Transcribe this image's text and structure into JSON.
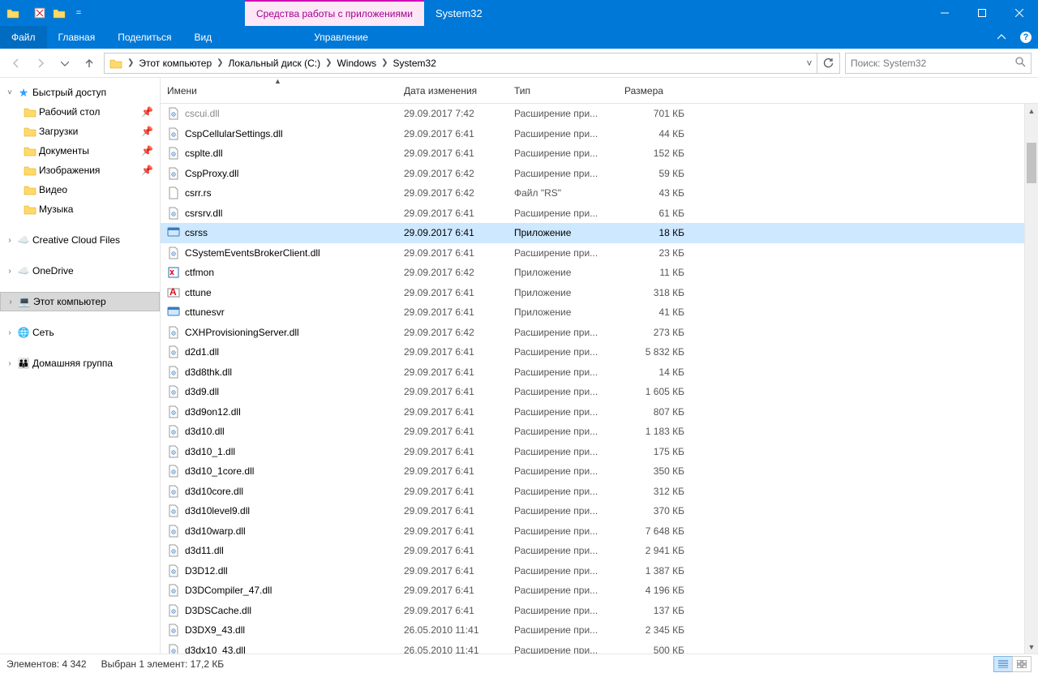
{
  "title": {
    "context_tab": "Средства работы с приложениями",
    "window": "System32"
  },
  "ribbon": {
    "file": "Файл",
    "tabs": [
      "Главная",
      "Поделиться",
      "Вид"
    ],
    "management": "Управление"
  },
  "address": {
    "crumbs": [
      "Этот компьютер",
      "Локальный диск (C:)",
      "Windows",
      "System32"
    ]
  },
  "search": {
    "placeholder": "Поиск: System32"
  },
  "nav": {
    "quick_access": "Быстрый доступ",
    "pinned": [
      {
        "label": "Рабочий стол"
      },
      {
        "label": "Загрузки"
      },
      {
        "label": "Документы"
      },
      {
        "label": "Изображения"
      },
      {
        "label": "Видео"
      },
      {
        "label": "Музыка"
      }
    ],
    "creative": "Creative Cloud Files",
    "onedrive": "OneDrive",
    "this_pc": "Этот компьютер",
    "network": "Сеть",
    "homegroup": "Домашняя группа"
  },
  "columns": {
    "name": "Имени",
    "date": "Дата изменения",
    "type": "Тип",
    "size": "Размера"
  },
  "files": [
    {
      "name": "cscui.dll",
      "date": "29.09.2017 7:42",
      "type": "Расширение при...",
      "size": "701 КБ",
      "icon": "dll",
      "cut": true
    },
    {
      "name": "CspCellularSettings.dll",
      "date": "29.09.2017 6:41",
      "type": "Расширение при...",
      "size": "44 КБ",
      "icon": "dll"
    },
    {
      "name": "csplte.dll",
      "date": "29.09.2017 6:41",
      "type": "Расширение при...",
      "size": "152 КБ",
      "icon": "dll"
    },
    {
      "name": "CspProxy.dll",
      "date": "29.09.2017 6:42",
      "type": "Расширение при...",
      "size": "59 КБ",
      "icon": "dll"
    },
    {
      "name": "csrr.rs",
      "date": "29.09.2017 6:42",
      "type": "Файл \"RS\"",
      "size": "43 КБ",
      "icon": "file"
    },
    {
      "name": "csrsrv.dll",
      "date": "29.09.2017 6:41",
      "type": "Расширение при...",
      "size": "61 КБ",
      "icon": "dll"
    },
    {
      "name": "csrss",
      "date": "29.09.2017 6:41",
      "type": "Приложение",
      "size": "18 КБ",
      "icon": "exe",
      "selected": true
    },
    {
      "name": "CSystemEventsBrokerClient.dll",
      "date": "29.09.2017 6:41",
      "type": "Расширение при...",
      "size": "23 КБ",
      "icon": "dll"
    },
    {
      "name": "ctfmon",
      "date": "29.09.2017 6:42",
      "type": "Приложение",
      "size": "11 КБ",
      "icon": "exe2"
    },
    {
      "name": "cttune",
      "date": "29.09.2017 6:41",
      "type": "Приложение",
      "size": "318 КБ",
      "icon": "exe3"
    },
    {
      "name": "cttunesvr",
      "date": "29.09.2017 6:41",
      "type": "Приложение",
      "size": "41 КБ",
      "icon": "exe"
    },
    {
      "name": "CXHProvisioningServer.dll",
      "date": "29.09.2017 6:42",
      "type": "Расширение при...",
      "size": "273 КБ",
      "icon": "dll"
    },
    {
      "name": "d2d1.dll",
      "date": "29.09.2017 6:41",
      "type": "Расширение при...",
      "size": "5 832 КБ",
      "icon": "dll"
    },
    {
      "name": "d3d8thk.dll",
      "date": "29.09.2017 6:41",
      "type": "Расширение при...",
      "size": "14 КБ",
      "icon": "dll"
    },
    {
      "name": "d3d9.dll",
      "date": "29.09.2017 6:41",
      "type": "Расширение при...",
      "size": "1 605 КБ",
      "icon": "dll"
    },
    {
      "name": "d3d9on12.dll",
      "date": "29.09.2017 6:41",
      "type": "Расширение при...",
      "size": "807 КБ",
      "icon": "dll"
    },
    {
      "name": "d3d10.dll",
      "date": "29.09.2017 6:41",
      "type": "Расширение при...",
      "size": "1 183 КБ",
      "icon": "dll"
    },
    {
      "name": "d3d10_1.dll",
      "date": "29.09.2017 6:41",
      "type": "Расширение при...",
      "size": "175 КБ",
      "icon": "dll"
    },
    {
      "name": "d3d10_1core.dll",
      "date": "29.09.2017 6:41",
      "type": "Расширение при...",
      "size": "350 КБ",
      "icon": "dll"
    },
    {
      "name": "d3d10core.dll",
      "date": "29.09.2017 6:41",
      "type": "Расширение при...",
      "size": "312 КБ",
      "icon": "dll"
    },
    {
      "name": "d3d10level9.dll",
      "date": "29.09.2017 6:41",
      "type": "Расширение при...",
      "size": "370 КБ",
      "icon": "dll"
    },
    {
      "name": "d3d10warp.dll",
      "date": "29.09.2017 6:41",
      "type": "Расширение при...",
      "size": "7 648 КБ",
      "icon": "dll"
    },
    {
      "name": "d3d11.dll",
      "date": "29.09.2017 6:41",
      "type": "Расширение при...",
      "size": "2 941 КБ",
      "icon": "dll"
    },
    {
      "name": "D3D12.dll",
      "date": "29.09.2017 6:41",
      "type": "Расширение при...",
      "size": "1 387 КБ",
      "icon": "dll"
    },
    {
      "name": "D3DCompiler_47.dll",
      "date": "29.09.2017 6:41",
      "type": "Расширение при...",
      "size": "4 196 КБ",
      "icon": "dll"
    },
    {
      "name": "D3DSCache.dll",
      "date": "29.09.2017 6:41",
      "type": "Расширение при...",
      "size": "137 КБ",
      "icon": "dll"
    },
    {
      "name": "D3DX9_43.dll",
      "date": "26.05.2010 11:41",
      "type": "Расширение при...",
      "size": "2 345 КБ",
      "icon": "dll"
    },
    {
      "name": "d3dx10_43.dll",
      "date": "26.05.2010 11:41",
      "type": "Расширение при...",
      "size": "500 КБ",
      "icon": "dll"
    }
  ],
  "status": {
    "count": "Элементов: 4 342",
    "selection": "Выбран 1 элемент: 17,2 КБ"
  }
}
